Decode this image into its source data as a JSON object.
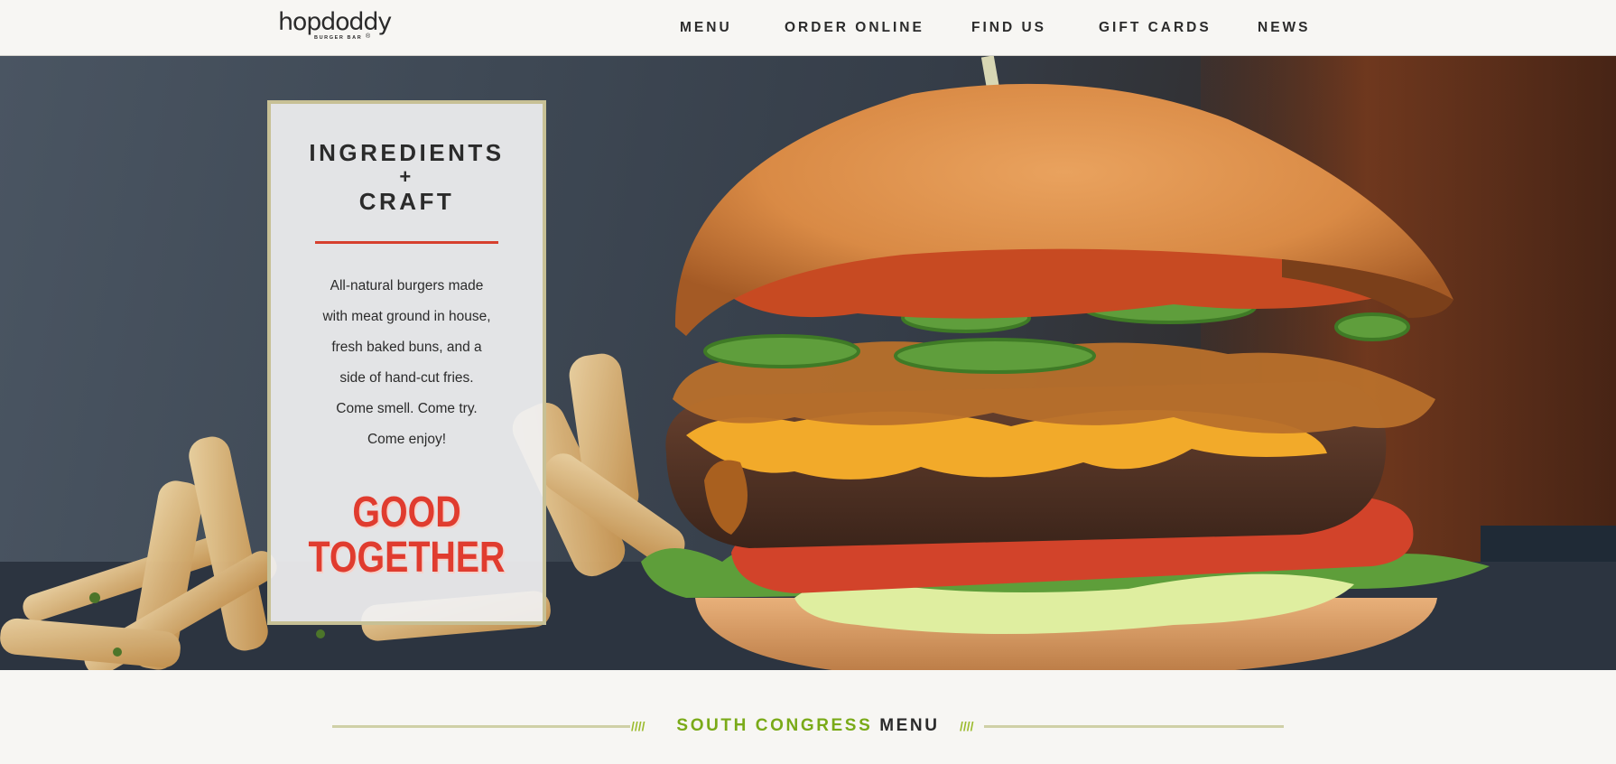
{
  "brand": {
    "logo_text": "hopdoddy",
    "logo_subtext": "BURGER BAR",
    "logo_mark": "®"
  },
  "nav": {
    "items": [
      {
        "label": "MENU"
      },
      {
        "label": "ORDER ONLINE"
      },
      {
        "label": "FIND US"
      },
      {
        "label": "GIFT CARDS"
      },
      {
        "label": "NEWS"
      }
    ]
  },
  "hero": {
    "image": "burger-and-fries-photo",
    "card": {
      "title_line1": "INGREDIENTS",
      "title_line2": "+",
      "title_line3": "CRAFT",
      "body_lines": [
        "All-natural burgers made",
        "with meat ground in house,",
        "fresh baked buns,  and a",
        "side of hand-cut fries.",
        "Come smell. Come try.",
        "Come enjoy!"
      ],
      "slogan_line1": "GOOD",
      "slogan_line2": "TOGETHER"
    }
  },
  "section": {
    "title_location": "SOUTH CONGRESS",
    "title_menu": "MENU",
    "hatch": "////"
  },
  "colors": {
    "accent_red": "#e03c2f",
    "accent_green": "#7aaa18",
    "card_border": "#c7c095",
    "text_dark": "#2b2b2b"
  }
}
